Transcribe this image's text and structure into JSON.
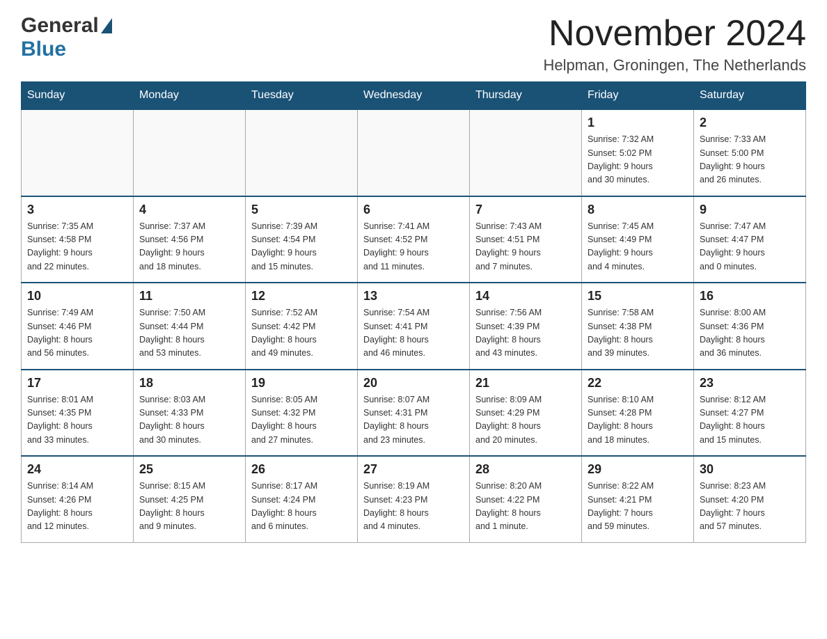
{
  "header": {
    "month_title": "November 2024",
    "subtitle": "Helpman, Groningen, The Netherlands",
    "logo_general": "General",
    "logo_blue": "Blue"
  },
  "calendar": {
    "days_of_week": [
      "Sunday",
      "Monday",
      "Tuesday",
      "Wednesday",
      "Thursday",
      "Friday",
      "Saturday"
    ],
    "weeks": [
      [
        {
          "day": "",
          "info": ""
        },
        {
          "day": "",
          "info": ""
        },
        {
          "day": "",
          "info": ""
        },
        {
          "day": "",
          "info": ""
        },
        {
          "day": "",
          "info": ""
        },
        {
          "day": "1",
          "info": "Sunrise: 7:32 AM\nSunset: 5:02 PM\nDaylight: 9 hours\nand 30 minutes."
        },
        {
          "day": "2",
          "info": "Sunrise: 7:33 AM\nSunset: 5:00 PM\nDaylight: 9 hours\nand 26 minutes."
        }
      ],
      [
        {
          "day": "3",
          "info": "Sunrise: 7:35 AM\nSunset: 4:58 PM\nDaylight: 9 hours\nand 22 minutes."
        },
        {
          "day": "4",
          "info": "Sunrise: 7:37 AM\nSunset: 4:56 PM\nDaylight: 9 hours\nand 18 minutes."
        },
        {
          "day": "5",
          "info": "Sunrise: 7:39 AM\nSunset: 4:54 PM\nDaylight: 9 hours\nand 15 minutes."
        },
        {
          "day": "6",
          "info": "Sunrise: 7:41 AM\nSunset: 4:52 PM\nDaylight: 9 hours\nand 11 minutes."
        },
        {
          "day": "7",
          "info": "Sunrise: 7:43 AM\nSunset: 4:51 PM\nDaylight: 9 hours\nand 7 minutes."
        },
        {
          "day": "8",
          "info": "Sunrise: 7:45 AM\nSunset: 4:49 PM\nDaylight: 9 hours\nand 4 minutes."
        },
        {
          "day": "9",
          "info": "Sunrise: 7:47 AM\nSunset: 4:47 PM\nDaylight: 9 hours\nand 0 minutes."
        }
      ],
      [
        {
          "day": "10",
          "info": "Sunrise: 7:49 AM\nSunset: 4:46 PM\nDaylight: 8 hours\nand 56 minutes."
        },
        {
          "day": "11",
          "info": "Sunrise: 7:50 AM\nSunset: 4:44 PM\nDaylight: 8 hours\nand 53 minutes."
        },
        {
          "day": "12",
          "info": "Sunrise: 7:52 AM\nSunset: 4:42 PM\nDaylight: 8 hours\nand 49 minutes."
        },
        {
          "day": "13",
          "info": "Sunrise: 7:54 AM\nSunset: 4:41 PM\nDaylight: 8 hours\nand 46 minutes."
        },
        {
          "day": "14",
          "info": "Sunrise: 7:56 AM\nSunset: 4:39 PM\nDaylight: 8 hours\nand 43 minutes."
        },
        {
          "day": "15",
          "info": "Sunrise: 7:58 AM\nSunset: 4:38 PM\nDaylight: 8 hours\nand 39 minutes."
        },
        {
          "day": "16",
          "info": "Sunrise: 8:00 AM\nSunset: 4:36 PM\nDaylight: 8 hours\nand 36 minutes."
        }
      ],
      [
        {
          "day": "17",
          "info": "Sunrise: 8:01 AM\nSunset: 4:35 PM\nDaylight: 8 hours\nand 33 minutes."
        },
        {
          "day": "18",
          "info": "Sunrise: 8:03 AM\nSunset: 4:33 PM\nDaylight: 8 hours\nand 30 minutes."
        },
        {
          "day": "19",
          "info": "Sunrise: 8:05 AM\nSunset: 4:32 PM\nDaylight: 8 hours\nand 27 minutes."
        },
        {
          "day": "20",
          "info": "Sunrise: 8:07 AM\nSunset: 4:31 PM\nDaylight: 8 hours\nand 23 minutes."
        },
        {
          "day": "21",
          "info": "Sunrise: 8:09 AM\nSunset: 4:29 PM\nDaylight: 8 hours\nand 20 minutes."
        },
        {
          "day": "22",
          "info": "Sunrise: 8:10 AM\nSunset: 4:28 PM\nDaylight: 8 hours\nand 18 minutes."
        },
        {
          "day": "23",
          "info": "Sunrise: 8:12 AM\nSunset: 4:27 PM\nDaylight: 8 hours\nand 15 minutes."
        }
      ],
      [
        {
          "day": "24",
          "info": "Sunrise: 8:14 AM\nSunset: 4:26 PM\nDaylight: 8 hours\nand 12 minutes."
        },
        {
          "day": "25",
          "info": "Sunrise: 8:15 AM\nSunset: 4:25 PM\nDaylight: 8 hours\nand 9 minutes."
        },
        {
          "day": "26",
          "info": "Sunrise: 8:17 AM\nSunset: 4:24 PM\nDaylight: 8 hours\nand 6 minutes."
        },
        {
          "day": "27",
          "info": "Sunrise: 8:19 AM\nSunset: 4:23 PM\nDaylight: 8 hours\nand 4 minutes."
        },
        {
          "day": "28",
          "info": "Sunrise: 8:20 AM\nSunset: 4:22 PM\nDaylight: 8 hours\nand 1 minute."
        },
        {
          "day": "29",
          "info": "Sunrise: 8:22 AM\nSunset: 4:21 PM\nDaylight: 7 hours\nand 59 minutes."
        },
        {
          "day": "30",
          "info": "Sunrise: 8:23 AM\nSunset: 4:20 PM\nDaylight: 7 hours\nand 57 minutes."
        }
      ]
    ]
  }
}
